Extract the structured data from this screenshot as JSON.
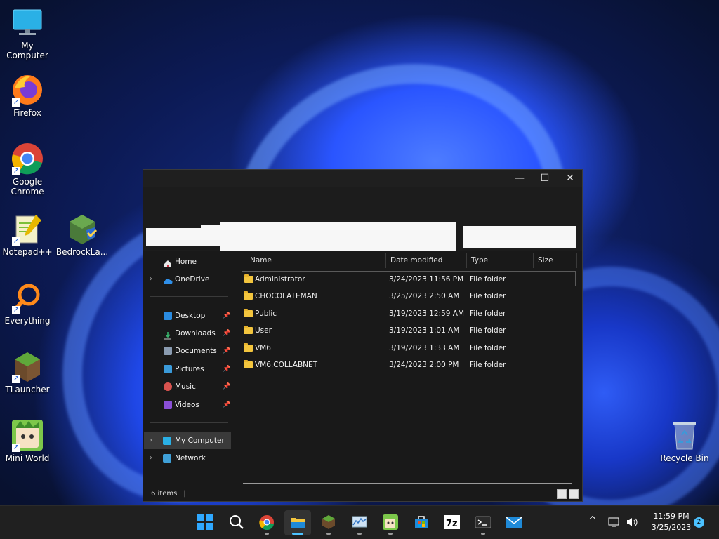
{
  "desktop": {
    "icons": [
      {
        "label": "My Computer",
        "icon": "monitor-icon"
      },
      {
        "label": "Firefox",
        "icon": "firefox-icon"
      },
      {
        "label": "Google Chrome",
        "icon": "chrome-icon"
      },
      {
        "label": "Notepad++",
        "icon": "notepad-plus-plus-icon"
      },
      {
        "label": "BedrockLa...",
        "icon": "bedrock-launcher-icon"
      },
      {
        "label": "Everything",
        "icon": "everything-search-icon"
      },
      {
        "label": "TLauncher",
        "icon": "tlauncher-icon"
      },
      {
        "label": "Mini World",
        "icon": "mini-world-icon"
      },
      {
        "label": "Recycle Bin",
        "icon": "recycle-bin-icon"
      }
    ]
  },
  "explorer": {
    "controls": {
      "minimize": "—",
      "maximize": "☐",
      "close": "✕"
    },
    "sidebar": {
      "items": [
        {
          "label": "Home",
          "icon": "home-icon"
        },
        {
          "label": "OneDrive",
          "icon": "cloud-icon"
        },
        {
          "label": "Desktop",
          "icon": "desktop-icon"
        },
        {
          "label": "Downloads",
          "icon": "download-icon"
        },
        {
          "label": "Documents",
          "icon": "document-icon"
        },
        {
          "label": "Pictures",
          "icon": "picture-icon"
        },
        {
          "label": "Music",
          "icon": "music-icon"
        },
        {
          "label": "Videos",
          "icon": "video-icon"
        },
        {
          "label": "My Computer",
          "icon": "monitor-icon"
        },
        {
          "label": "Network",
          "icon": "network-icon"
        }
      ]
    },
    "columns": {
      "name": "Name",
      "date": "Date modified",
      "type": "Type",
      "size": "Size"
    },
    "files": [
      {
        "name": "Administrator",
        "date": "3/24/2023 11:56 PM",
        "type": "File folder"
      },
      {
        "name": "CHOCOLATEMAN",
        "date": "3/25/2023 2:50 AM",
        "type": "File folder"
      },
      {
        "name": "Public",
        "date": "3/19/2023 12:59 AM",
        "type": "File folder"
      },
      {
        "name": "User",
        "date": "3/19/2023 1:01 AM",
        "type": "File folder"
      },
      {
        "name": "VM6",
        "date": "3/19/2023 1:33 AM",
        "type": "File folder"
      },
      {
        "name": "VM6.COLLABNET",
        "date": "3/24/2023 2:00 PM",
        "type": "File folder"
      }
    ],
    "status": {
      "count": "6 items",
      "separator": "|"
    }
  },
  "taskbar": {
    "apps": [
      "start-icon",
      "search-icon",
      "chrome-icon",
      "file-explorer-icon",
      "minecraft-icon",
      "resource-monitor-icon",
      "mini-world-icon",
      "microsoft-store-icon",
      "7zip-icon",
      "terminal-icon",
      "mail-icon"
    ],
    "tray": {
      "overflow": "^",
      "time": "11:59 PM",
      "date": "3/25/2023",
      "notifications": "2"
    }
  },
  "colors": {
    "accent": "#4cc2ff",
    "folder": "#f3c53e",
    "window_bg": "#191919",
    "taskbar_bg": "#202020"
  }
}
